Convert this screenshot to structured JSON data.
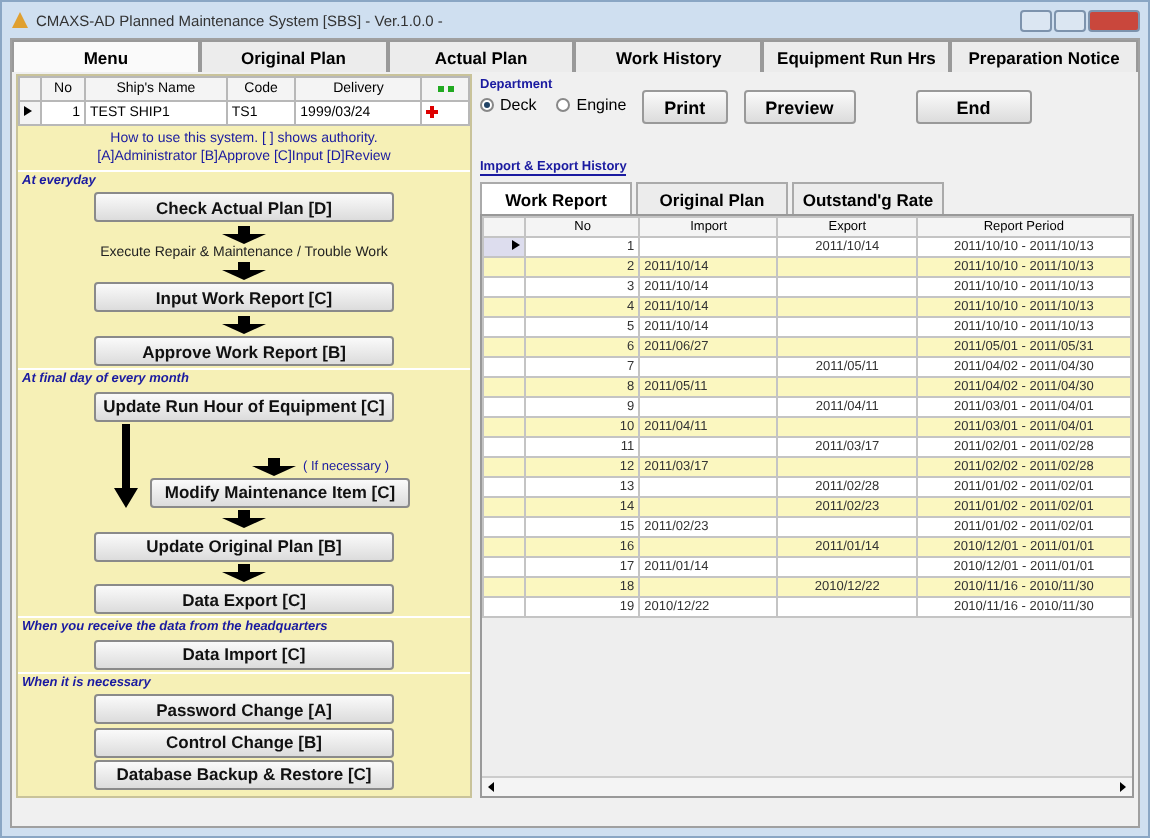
{
  "window": {
    "title": "CMAXS-AD Planned Maintenance System [SBS] - Ver.1.0.0 -"
  },
  "tabs": [
    {
      "label": "Menu",
      "selected": true
    },
    {
      "label": "Original Plan",
      "selected": false
    },
    {
      "label": "Actual Plan",
      "selected": false
    },
    {
      "label": "Work History",
      "selected": false
    },
    {
      "label": "Equipment Run Hrs",
      "selected": false
    },
    {
      "label": "Preparation Notice",
      "selected": false
    }
  ],
  "ship_table": {
    "columns": [
      "No",
      "Ship's Name",
      "Code",
      "Delivery"
    ],
    "rows": [
      {
        "cells": [
          "1",
          "TEST SHIP1",
          "TS1",
          "1999/03/24"
        ],
        "selected": true
      }
    ]
  },
  "help": {
    "line_1": "How to use this system. [ ] shows authority.",
    "line_2": "[A]Administrator [B]Approve [C]Input [D]Review"
  },
  "menu": [
    {
      "kind": "section",
      "text": "At everyday"
    },
    {
      "kind": "button",
      "text": "Check Actual Plan [D]"
    },
    {
      "kind": "arrow"
    },
    {
      "kind": "note",
      "text": "Execute Repair & Maintenance / Trouble Work"
    },
    {
      "kind": "arrow"
    },
    {
      "kind": "button",
      "text": "Input Work Report [C]"
    },
    {
      "kind": "arrow"
    },
    {
      "kind": "button",
      "text": "Approve Work Report [B]"
    },
    {
      "kind": "section",
      "text": "At final day of every month"
    },
    {
      "kind": "button",
      "text": "Update Run Hour of Equipment [C]"
    },
    {
      "kind": "branch",
      "note": "( If necessary )",
      "button": "Modify Maintenance Item [C]"
    },
    {
      "kind": "arrow"
    },
    {
      "kind": "button",
      "text": "Update Original Plan [B]"
    },
    {
      "kind": "arrow"
    },
    {
      "kind": "button",
      "text": "Data Export [C]"
    },
    {
      "kind": "section",
      "text": "When you receive the data from the headquarters"
    },
    {
      "kind": "button",
      "text": "Data Import [C]"
    },
    {
      "kind": "section",
      "text": "When it is necessary"
    },
    {
      "kind": "button",
      "text": "Password Change [A]"
    },
    {
      "kind": "button",
      "text": "Control Change [B]"
    },
    {
      "kind": "button",
      "text": "Database Backup & Restore [C]"
    }
  ],
  "department": {
    "label": "Department",
    "options": [
      {
        "label": "Deck",
        "selected": true
      },
      {
        "label": "Engine",
        "selected": false
      }
    ]
  },
  "actions": [
    "Print",
    "Preview",
    "End"
  ],
  "history": {
    "label": "Import & Export History",
    "tabs": [
      {
        "label": "Work Report",
        "selected": true
      },
      {
        "label": "Original Plan",
        "selected": false
      },
      {
        "label": "Outstand'g Rate",
        "selected": false
      }
    ],
    "columns": [
      "No",
      "Import",
      "Export",
      "Report Period"
    ],
    "rows": [
      {
        "no": "1",
        "import": "",
        "export": "2011/10/14",
        "period": "2011/10/10 - 2011/10/13",
        "selected": true
      },
      {
        "no": "2",
        "import": "2011/10/14",
        "export": "",
        "period": "2011/10/10 - 2011/10/13",
        "selected": false
      },
      {
        "no": "3",
        "import": "2011/10/14",
        "export": "",
        "period": "2011/10/10 - 2011/10/13",
        "selected": false
      },
      {
        "no": "4",
        "import": "2011/10/14",
        "export": "",
        "period": "2011/10/10 - 2011/10/13",
        "selected": false
      },
      {
        "no": "5",
        "import": "2011/10/14",
        "export": "",
        "period": "2011/10/10 - 2011/10/13",
        "selected": false
      },
      {
        "no": "6",
        "import": "2011/06/27",
        "export": "",
        "period": "2011/05/01 - 2011/05/31",
        "selected": false
      },
      {
        "no": "7",
        "import": "",
        "export": "2011/05/11",
        "period": "2011/04/02 - 2011/04/30",
        "selected": false
      },
      {
        "no": "8",
        "import": "2011/05/11",
        "export": "",
        "period": "2011/04/02 - 2011/04/30",
        "selected": false
      },
      {
        "no": "9",
        "import": "",
        "export": "2011/04/11",
        "period": "2011/03/01 - 2011/04/01",
        "selected": false
      },
      {
        "no": "10",
        "import": "2011/04/11",
        "export": "",
        "period": "2011/03/01 - 2011/04/01",
        "selected": false
      },
      {
        "no": "11",
        "import": "",
        "export": "2011/03/17",
        "period": "2011/02/01 - 2011/02/28",
        "selected": false
      },
      {
        "no": "12",
        "import": "2011/03/17",
        "export": "",
        "period": "2011/02/02 - 2011/02/28",
        "selected": false
      },
      {
        "no": "13",
        "import": "",
        "export": "2011/02/28",
        "period": "2011/01/02 - 2011/02/01",
        "selected": false
      },
      {
        "no": "14",
        "import": "",
        "export": "2011/02/23",
        "period": "2011/01/02 - 2011/02/01",
        "selected": false
      },
      {
        "no": "15",
        "import": "2011/02/23",
        "export": "",
        "period": "2011/01/02 - 2011/02/01",
        "selected": false
      },
      {
        "no": "16",
        "import": "",
        "export": "2011/01/14",
        "period": "2010/12/01 - 2011/01/01",
        "selected": false
      },
      {
        "no": "17",
        "import": "2011/01/14",
        "export": "",
        "period": "2010/12/01 - 2011/01/01",
        "selected": false
      },
      {
        "no": "18",
        "import": "",
        "export": "2010/12/22",
        "period": "2010/11/16 - 2010/11/30",
        "selected": false
      },
      {
        "no": "19",
        "import": "2010/12/22",
        "export": "",
        "period": "2010/11/16 - 2010/11/30",
        "selected": false
      }
    ]
  }
}
